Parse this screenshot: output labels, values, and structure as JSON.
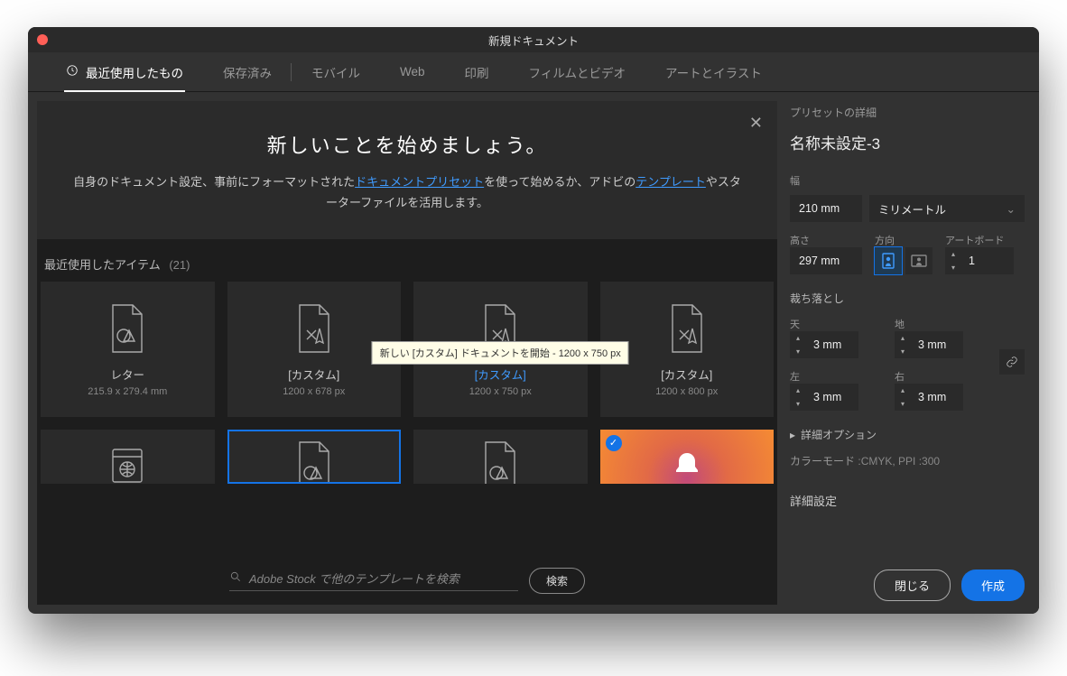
{
  "window": {
    "title": "新規ドキュメント"
  },
  "tabs": {
    "recent": {
      "label": "最近使用したもの"
    },
    "saved": {
      "label": "保存済み"
    },
    "mobile": {
      "label": "モバイル"
    },
    "web": {
      "label": "Web"
    },
    "print": {
      "label": "印刷"
    },
    "film": {
      "label": "フィルムとビデオ"
    },
    "art": {
      "label": "アートとイラスト"
    }
  },
  "hero": {
    "title": "新しいことを始めましょう。",
    "body_1": "自身のドキュメント設定、事前にフォーマットされた",
    "link_1": "ドキュメントプリセット",
    "body_2": "を使って始めるか、アドビの",
    "link_2": "テンプレート",
    "body_3": "やスターターファイルを活用します。"
  },
  "recent": {
    "label": "最近使用したアイテム",
    "count": "(21)"
  },
  "presets": [
    {
      "name": "レター",
      "dim": "215.9 x 279.4 mm"
    },
    {
      "name": "[カスタム]",
      "dim": "1200 x 678 px"
    },
    {
      "name": "[カスタム]",
      "dim": "1200 x 750 px"
    },
    {
      "name": "[カスタム]",
      "dim": "1200 x 800 px"
    }
  ],
  "tooltip": "新しい [カスタム] ドキュメントを開始 - 1200 x 750 px",
  "search": {
    "placeholder": "Adobe Stock で他のテンプレートを検索",
    "button": "検索"
  },
  "panel": {
    "preset_label": "プリセットの詳細",
    "preset_name": "名称未設定-3",
    "width_label": "幅",
    "width_value": "210 mm",
    "unit": "ミリメートル",
    "height_label": "高さ",
    "height_value": "297 mm",
    "orientation_label": "方向",
    "artboards_label": "アートボード",
    "artboards_value": "1",
    "bleed_label": "裁ち落とし",
    "top_label": "天",
    "bottom_label": "地",
    "left_label": "左",
    "right_label": "右",
    "bleed_value": "3 mm",
    "adv_options": "詳細オプション",
    "color_mode_label": "カラーモード",
    "color_mode_value": ":CMYK, PPI :300",
    "adv_settings": "詳細設定"
  },
  "footer": {
    "close": "閉じる",
    "create": "作成"
  }
}
